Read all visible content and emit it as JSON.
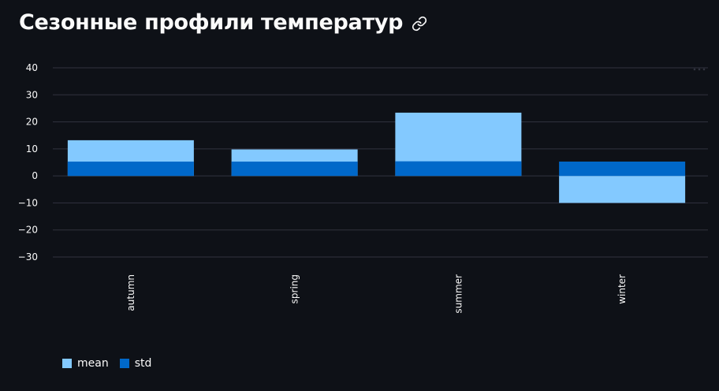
{
  "header": {
    "title": "Сезонные профили температур",
    "link_icon": "link-icon"
  },
  "toolbar": {
    "more_icon": "more-horizontal-icon"
  },
  "colors": {
    "background": "#0e1117",
    "grid": "#31333f",
    "text": "#fafafa",
    "mean": "#83c9ff",
    "std": "#0068c9"
  },
  "chart_data": {
    "type": "bar",
    "stacked": true,
    "categories": [
      "autumn",
      "spring",
      "summer",
      "winter"
    ],
    "series": [
      {
        "name": "mean",
        "color": "#83c9ff",
        "values": [
          13.2,
          9.8,
          23.4,
          -10.0
        ]
      },
      {
        "name": "std",
        "color": "#0068c9",
        "values": [
          5.3,
          5.3,
          5.4,
          5.3
        ]
      }
    ],
    "ylim": [
      -35,
      45
    ],
    "yticks": [
      40,
      30,
      20,
      10,
      0,
      -10,
      -20,
      -30
    ],
    "ytick_labels": [
      "40",
      "30",
      "20",
      "10",
      "0",
      "−10",
      "−20",
      "−30"
    ],
    "grid": true,
    "legend_position": "bottom-left",
    "xlabel": "",
    "ylabel": ""
  }
}
